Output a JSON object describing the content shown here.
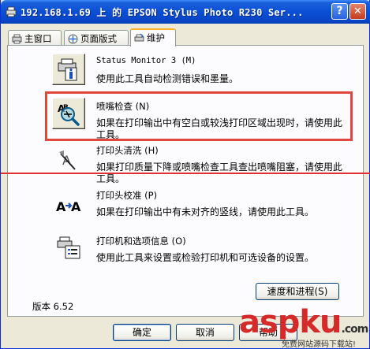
{
  "window": {
    "title": "192.168.1.69 上 的 EPSON Stylus Photo R230 Ser...",
    "help_label": "?",
    "close_label": "✕"
  },
  "tabs": [
    {
      "label": "主窗口",
      "icon": "main-window-icon"
    },
    {
      "label": "页面版式",
      "icon": "page-layout-icon"
    },
    {
      "label": "维护",
      "icon": "maintenance-icon",
      "active": true
    }
  ],
  "tools": [
    {
      "title": "Status Monitor 3 (M)",
      "desc": "使用此工具自动检测错误和墨量。",
      "icon": "status-monitor-icon"
    },
    {
      "title": "喷嘴检查 (N)",
      "desc": "如果在打印输出中有空白或较浅打印区域出现时，请使用此工具。",
      "icon": "nozzle-check-icon"
    },
    {
      "title": "打印头清洗 (H)",
      "desc": "如果打印质量下降或喷嘴检查工具查出喷嘴阻塞，请使用此工具。",
      "icon": "head-cleaning-icon"
    },
    {
      "title": "打印头校准 (P)",
      "desc": "如果在打印输出中有未对齐的竖线，请使用此工具。",
      "icon": "head-alignment-icon"
    },
    {
      "title": "打印机和选项信息 (O)",
      "desc": "使用此工具来设置或检验打印机和可选设备的设置。",
      "icon": "printer-info-icon"
    }
  ],
  "speed_button": "速度和进程(S)",
  "version": "版本 6.52",
  "ok_button": "确定",
  "cancel_button": "取消",
  "help_button": "帮助",
  "watermark": {
    "brand": "aspku",
    "suffix": ".com",
    "sub": "免费网站源码下载站!"
  },
  "colors": {
    "titlebar": "#0b4fd6",
    "highlight": "#e0473f",
    "tab_accent": "#f8b32b",
    "watermark": "#d42a2a"
  }
}
